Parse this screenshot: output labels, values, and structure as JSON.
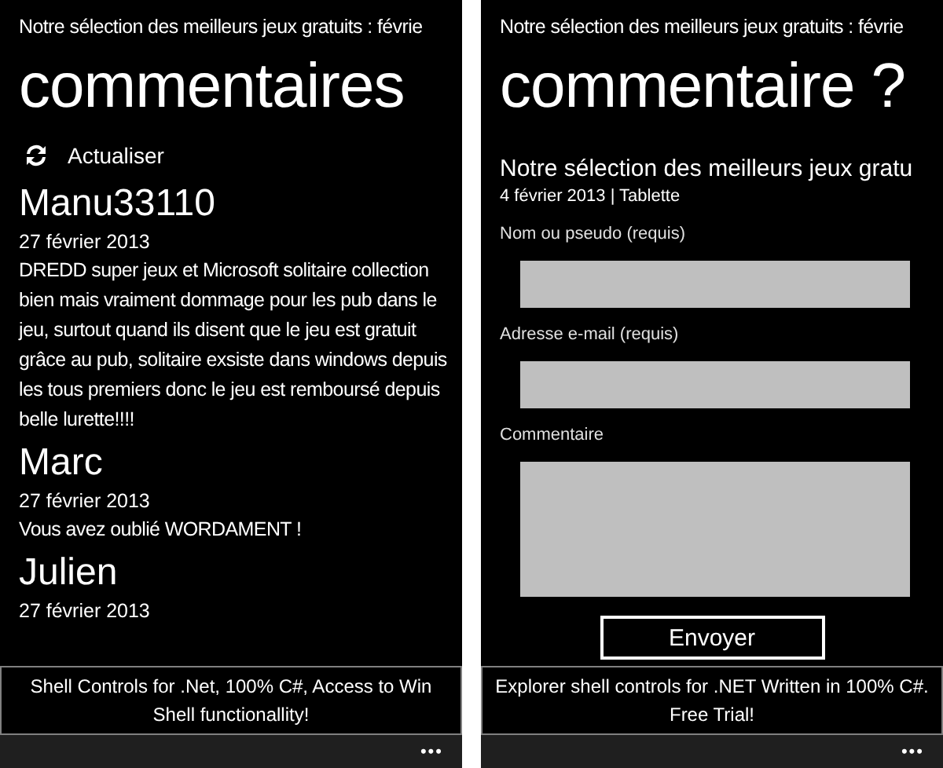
{
  "comments_screen": {
    "subtitle": "Notre sélection des meilleurs jeux gratuits : févrie",
    "title": "commentaires",
    "refresh_label": "Actualiser",
    "comments": [
      {
        "author": "Manu33110",
        "date": "27 février 2013",
        "text": "DREDD super jeux et Microsoft solitaire collection bien mais vraiment dommage pour les pub dans le jeu, surtout quand ils disent que le jeu est gratuit grâce au pub, solitaire exsiste dans windows depuis les tous premiers donc le jeu est remboursé depuis belle lurette!!!!"
      },
      {
        "author": "Marc",
        "date": "27 février 2013",
        "text": "Vous avez oublié WORDAMENT !"
      },
      {
        "author": "Julien",
        "date": "27 février 2013"
      }
    ],
    "ad": "Shell Controls for .Net, 100% C#, Access to Win Shell functionallity!",
    "more": "•••"
  },
  "form_screen": {
    "subtitle": "Notre sélection des meilleurs jeux gratuits : févrie",
    "title": "commentaire ?",
    "article_title": "Notre sélection des meilleurs jeux gratu",
    "article_meta": "4 février 2013 | Tablette",
    "fields": [
      {
        "label": "Nom ou pseudo (requis)",
        "kind": "input"
      },
      {
        "label": "Adresse e-mail (requis)",
        "kind": "input"
      },
      {
        "label": "Commentaire",
        "kind": "textarea"
      }
    ],
    "submit": "Envoyer",
    "ad": "Explorer shell controls for .NET Written in 100% C#. Free Trial!",
    "more": "•••"
  }
}
